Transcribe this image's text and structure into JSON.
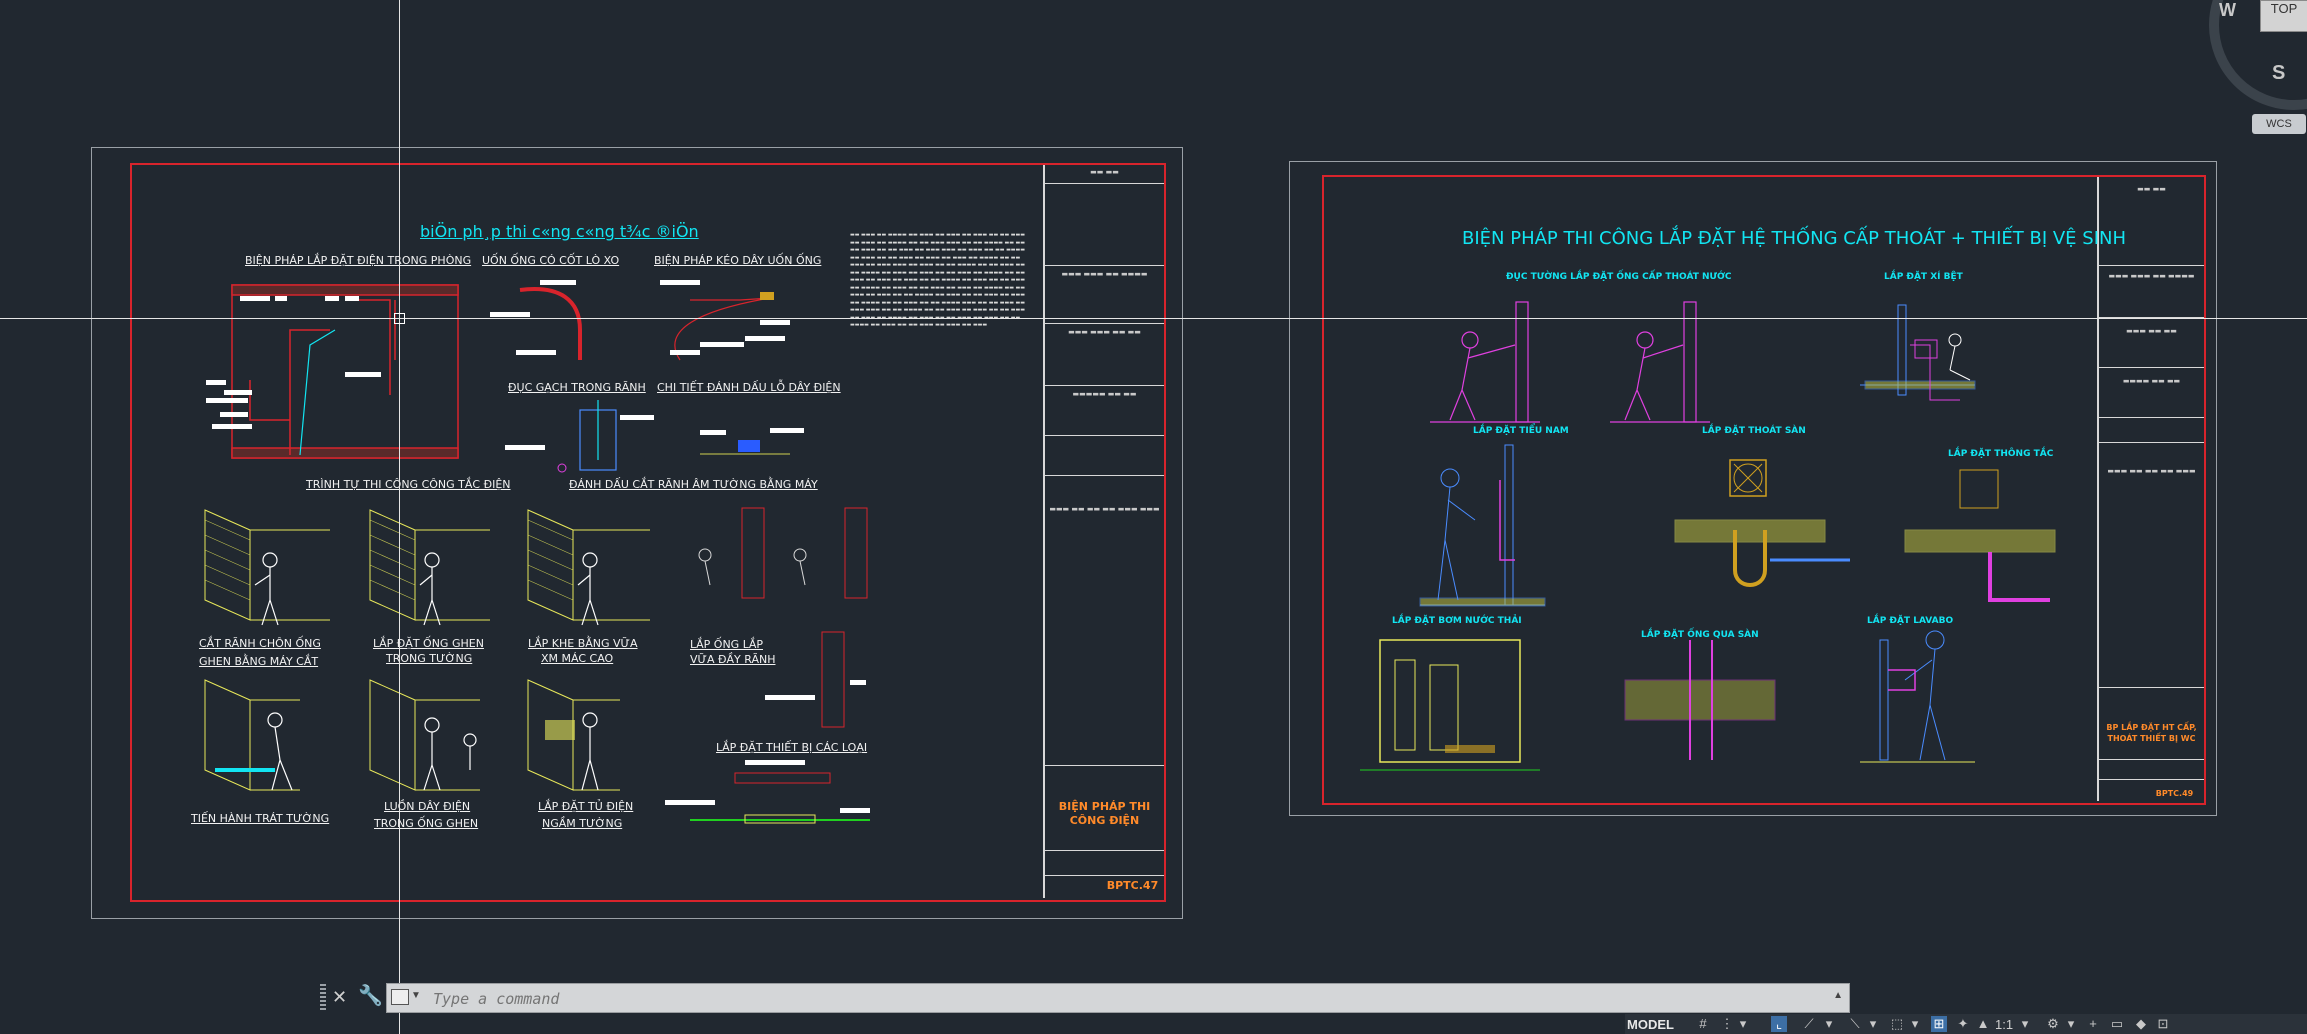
{
  "drawing_left": {
    "title": "biÖn ph¸p thi c«ng c«ng t¾c ®iÖn",
    "labels": {
      "lap_dat_dien_phong": "BIỆN PHÁP LẮP ĐẶT ĐIỆN TRONG PHÒNG",
      "uon_ong": "UỐN ỐNG CÓ CỐT LÒ XO",
      "keo_day": "BIỆN PHÁP KÉO DÂY UỐN ỐNG",
      "duc_gach": "ĐỤC GẠCH TRONG RÃNH",
      "danh_dau_lo": "CHI TIẾT ĐÁNH DẤU LỖ DÂY ĐIỆN",
      "trinh_tu": "TRÌNH TỰ THI CÔNG CÔNG TẮC ĐIỆN",
      "danh_dau_cat": "ĐÁNH DẤU CẮT RÃNH ÂM TƯỜNG BẰNG MÁY",
      "cat_ranh_1": "CẮT RÃNH CHÔN ỐNG",
      "cat_ranh_2": "GHEN BẰNG MÁY CẮT",
      "lap_ong_ghen_1": "LẮP ĐẶT ỐNG GHEN",
      "lap_ong_ghen_2": "TRONG TƯỜNG",
      "lap_khe_1": "LẮP KHE BẰNG VỮA",
      "lap_khe_2": "XM MÁC CAO",
      "lap_ong_lap_1": "LẮP ỐNG LẮP",
      "lap_ong_lap_2": "VỮA ĐẦY RÃNH",
      "lap_thiet_bi": "LẮP ĐẶT THIẾT BỊ CÁC LOẠI",
      "trat_tuong": "TIẾN HÀNH TRÁT TƯỜNG",
      "luon_day_1": "LUỒN DÂY ĐIỆN",
      "luon_day_2": "TRONG ỐNG GHEN",
      "lap_tu_1": "LẮP ĐẶT TỦ ĐIỆN",
      "lap_tu_2": "NGẦM TƯỜNG"
    },
    "title_block": {
      "sheet_title": "BIỆN PHÁP THI CÔNG ĐIỆN",
      "sheet_code": "BPTC.47"
    }
  },
  "drawing_right": {
    "title": "BIỆN PHÁP THI CÔNG LẮP ĐẶT HỆ THỐNG CẤP THOÁT + THIẾT BỊ VỆ SINH",
    "labels": {
      "duc_tuong": "ĐỤC TƯỜNG LẮP ĐẶT ỐNG CẤP THOÁT NƯỚC",
      "xi_bet": "LẮP ĐẶT XÍ BỆT",
      "tieu_nam": "LẮP ĐẶT TIỂU NAM",
      "thoat_san": "LẮP ĐẶT THOÁT SÀN",
      "thong_tac": "LẮP ĐẶT THÔNG TẮC",
      "bom_nuoc": "LẮP ĐẶT BƠM NƯỚC THẢI",
      "ong_qua_san": "LẮP ĐẶT ỐNG QUA SÀN",
      "lavabo": "LẮP ĐẶT LAVABO"
    },
    "title_block": {
      "sheet_title": "BP LẮP ĐẶT HT CẤP, THOÁT THIẾT BỊ WC",
      "sheet_code": "BPTC.49"
    }
  },
  "viewcube": {
    "top_label": "TOP",
    "west_label": "W",
    "south_label": "S",
    "wcs_label": "WCS"
  },
  "command_line": {
    "placeholder": "Type a command"
  },
  "status_bar": {
    "model_label": "MODEL",
    "scale_label": "1:1"
  },
  "colors": {
    "background": "#212830",
    "sheet_border": "#d8242c",
    "title_cyan": "#12e5f2",
    "figure_yellow": "#e8e85a",
    "figure_magenta": "#e040e0",
    "figure_blue": "#5a9cff"
  }
}
